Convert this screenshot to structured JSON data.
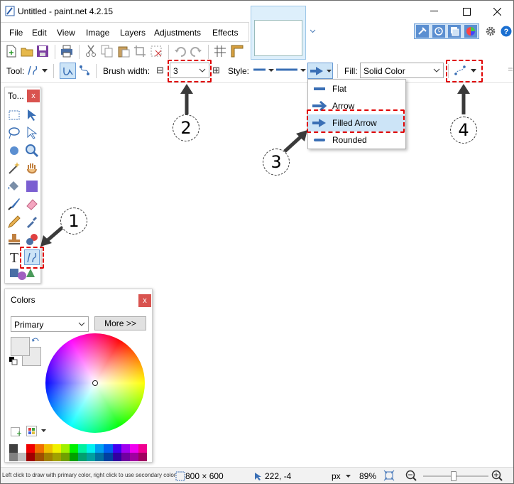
{
  "window": {
    "title": "Untitled - paint.net 4.2.15",
    "minimize": "—",
    "maximize": "☐",
    "close": "✕"
  },
  "menu": [
    "File",
    "Edit",
    "View",
    "Image",
    "Layers",
    "Adjustments",
    "Effects"
  ],
  "toolbar": {
    "tool_label": "Tool:",
    "brush_width_label": "Brush width:",
    "brush_width_value": "3",
    "minus": "⊟",
    "plus": "⊞",
    "style_label": "Style:",
    "fill_label": "Fill:",
    "fill_value": "Solid Color"
  },
  "arrow_menu": {
    "items": [
      "Flat",
      "Arrow",
      "Filled Arrow",
      "Rounded"
    ],
    "selected": "Filled Arrow"
  },
  "tools_panel": {
    "title": "To...",
    "close": "x"
  },
  "colors_panel": {
    "title": "Colors",
    "close": "x",
    "mode": "Primary",
    "more_button": "More >>",
    "palette_top": [
      "#404040",
      "#ffffff",
      "#f00000",
      "#f07000",
      "#f0c000",
      "#f0f000",
      "#a0f000",
      "#00f000",
      "#00f0a0",
      "#00f0f0",
      "#00a0f0",
      "#0060f0",
      "#4000f0",
      "#a000f0",
      "#f000f0",
      "#f00090"
    ],
    "palette_bottom": [
      "#808080",
      "#c0c0c0",
      "#a00000",
      "#a05000",
      "#a08000",
      "#a0a000",
      "#70a000",
      "#00a000",
      "#00a070",
      "#00a0a0",
      "#0070a0",
      "#0040a0",
      "#3000a0",
      "#7000a0",
      "#a000a0",
      "#a00060"
    ]
  },
  "status": {
    "hint": "Left click to draw with primary color, right click to use secondary color",
    "size": "800 × 600",
    "cursor": "222, -4",
    "units": "px",
    "zoom": "89%"
  },
  "callouts": [
    "1",
    "2",
    "3",
    "4"
  ],
  "colors": {
    "accent": "#0078d7",
    "highlight_red": "#e00000",
    "selected_tool_bg": "#cce4f7"
  }
}
